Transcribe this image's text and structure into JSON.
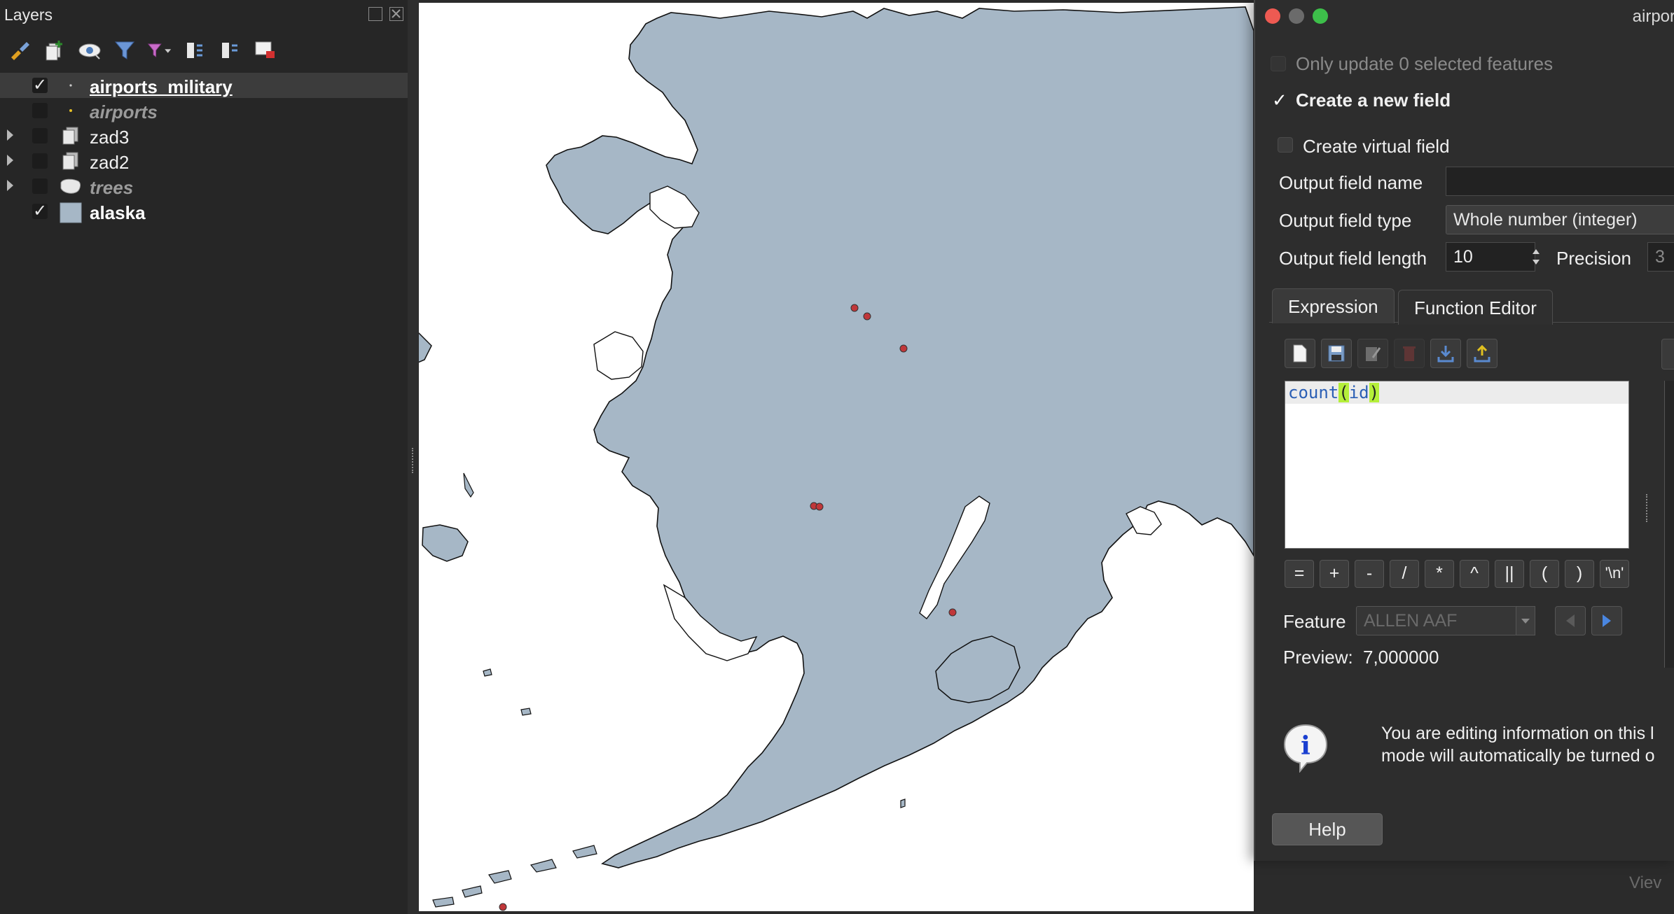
{
  "layers_panel": {
    "title": "Layers",
    "toolbar_icons": [
      "style-brush-icon",
      "add-group-icon",
      "visibility-eye-icon",
      "filter-icon",
      "filter-expression-icon",
      "expand-all-icon",
      "collapse-all-icon",
      "remove-layer-icon"
    ],
    "layers": [
      {
        "name": "airports_military",
        "checked": true,
        "selected": true,
        "expandable": false,
        "icon": "point-layer-icon",
        "style": "bold-underline"
      },
      {
        "name": "airports",
        "checked": false,
        "selected": false,
        "expandable": false,
        "icon": "point-layer-icon",
        "style": "italic"
      },
      {
        "name": "zad3",
        "checked": false,
        "selected": false,
        "expandable": true,
        "icon": "group-icon",
        "style": "normal"
      },
      {
        "name": "zad2",
        "checked": false,
        "selected": false,
        "expandable": true,
        "icon": "group-icon",
        "style": "normal"
      },
      {
        "name": "trees",
        "checked": false,
        "selected": false,
        "expandable": true,
        "icon": "polygon-layer-icon",
        "style": "italic"
      },
      {
        "name": "alaska",
        "checked": true,
        "selected": false,
        "expandable": false,
        "icon": "polygon-fill-icon",
        "style": "bold"
      }
    ]
  },
  "map": {
    "land_color": "#a6b7c6",
    "airport_color": "#c0373a"
  },
  "dialog": {
    "title": "airpor",
    "only_update_label": "Only update 0 selected features",
    "create_new_field_label": "Create a new field",
    "create_new_field_checked": true,
    "create_virtual_label": "Create virtual field",
    "output_name_label": "Output field name",
    "output_name_value": "",
    "output_type_label": "Output field type",
    "output_type_value": "Whole number (integer)",
    "output_length_label": "Output field length",
    "output_length_value": "10",
    "precision_label": "Precision",
    "precision_value": "3",
    "tabs": [
      "Expression",
      "Function Editor"
    ],
    "expression_parts": [
      "count",
      "(",
      "id",
      ")"
    ],
    "operators": [
      "=",
      "+",
      "-",
      "/",
      "*",
      "^",
      "||",
      "(",
      ")",
      "'\\n'"
    ],
    "feature_label": "Feature",
    "feature_value": "ALLEN AAF",
    "preview_label": "Preview:",
    "preview_value": "7,000000",
    "info_line1": "You are editing information on this l",
    "info_line2": "mode will automatically be turned o",
    "help_label": "Help"
  },
  "background_peek": "Viev"
}
